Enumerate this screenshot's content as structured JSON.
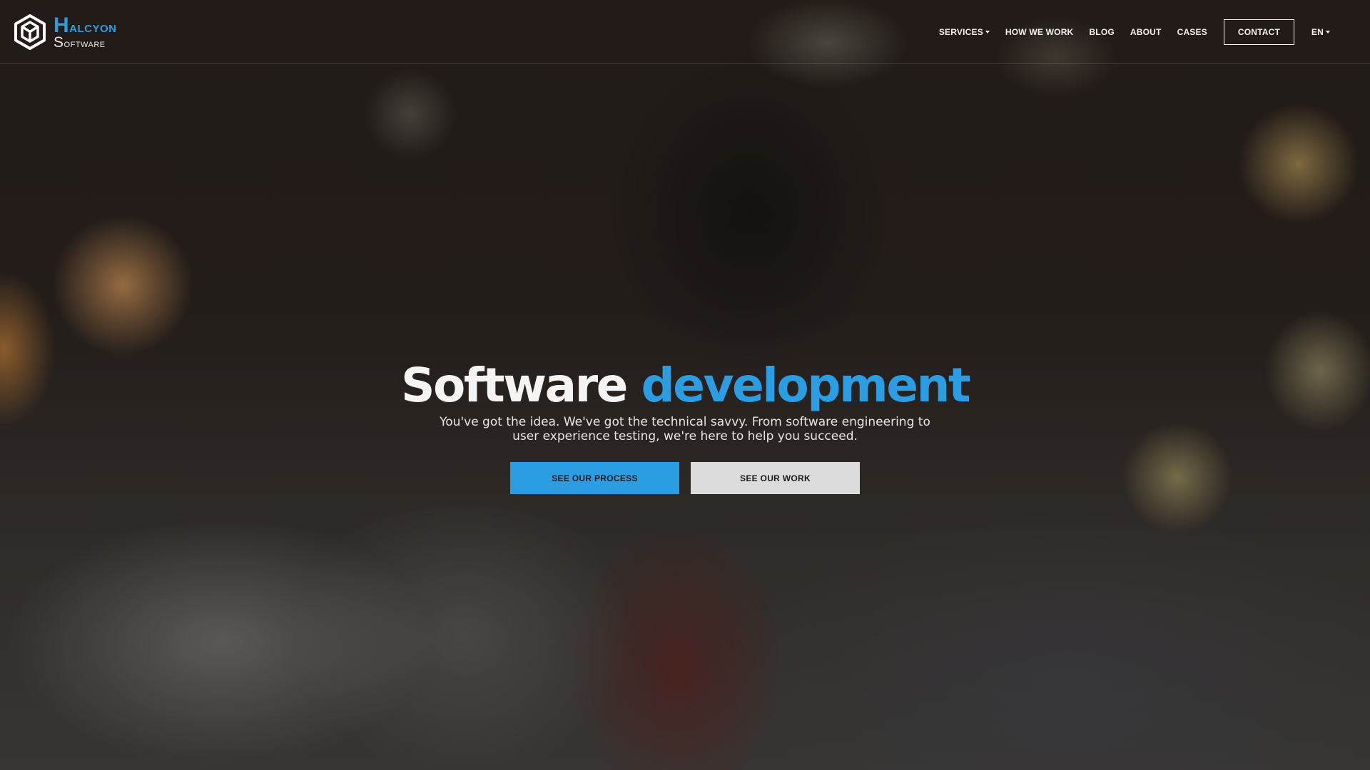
{
  "brand": {
    "name_top": "Halcyon",
    "name_bottom": "Software",
    "accent_color": "#2a9de3",
    "icon": "hexagon-cube-icon"
  },
  "nav": {
    "services": "SERVICES",
    "how_we_work": "HOW WE WORK",
    "blog": "BLOG",
    "about": "ABOUT",
    "cases": "CASES",
    "contact": "CONTACT",
    "language": "EN"
  },
  "hero": {
    "headline_part1": "Software",
    "headline_part2": "development",
    "subtext": "You've got the idea. We've got the technical savvy. From software engineering to user experience testing, we're here to help you succeed.",
    "primary_button": "SEE OUR PROCESS",
    "secondary_button": "SEE OUR WORK"
  }
}
